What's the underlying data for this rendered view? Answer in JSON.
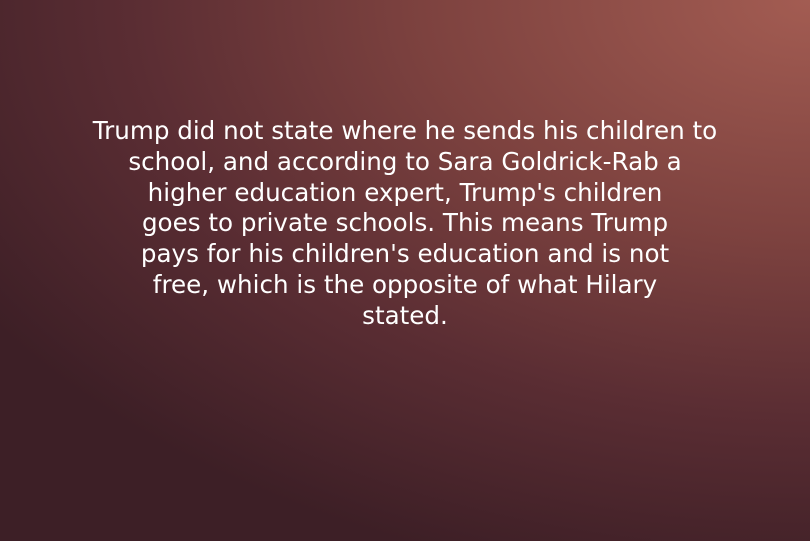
{
  "slide": {
    "text": "Trump did not state where he sends his children to\nschool, and according to Sara Goldrick-Rab a\nhigher education expert, Trump's children\ngoes to private schools. This means Trump\npays for his children's education and is not\nfree, which is the opposite of what Hilary\nstated."
  },
  "colors": {
    "text": "#ffffff",
    "background_light": "#a35c52",
    "background_dark": "#3d1f26"
  }
}
